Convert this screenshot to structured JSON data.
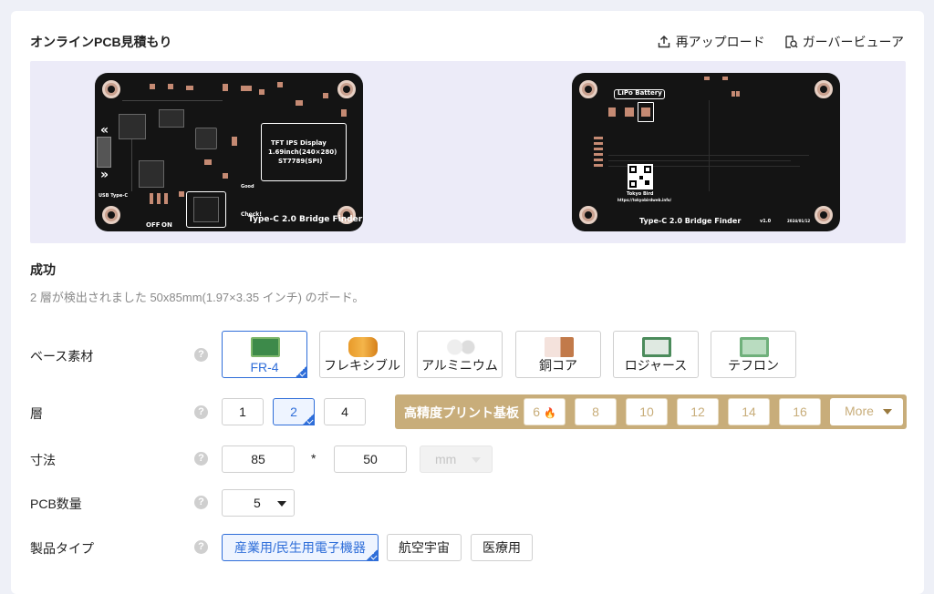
{
  "header": {
    "title": "オンラインPCB見積もり",
    "reupload": "再アップロード",
    "gerber_viewer": "ガーバービューア"
  },
  "preview": {
    "front": {
      "display_l1": "TFT IPS Display",
      "display_l2": "1.69inch(240×280)",
      "display_l3": "ST7789(SPI)",
      "board_name": "Type-C 2.0 Bridge Finder",
      "usb_label": "USB Type-C",
      "off": "OFF",
      "on": "ON",
      "good": "Good",
      "check": "Check!"
    },
    "back": {
      "lipo": "LiPo Battery",
      "board_name": "Type-C 2.0 Bridge Finder",
      "version": "v1.0",
      "date": "2024/01/12",
      "maker": "Tokyo Bird",
      "url": "https://tokyobirdweb.info/"
    }
  },
  "status": {
    "title": "成功",
    "detected": "2 層が検出されました 50x85mm(1.97×3.35 インチ) のボード。"
  },
  "base_material": {
    "label": "ベース素材",
    "help": "?",
    "options": [
      "FR-4",
      "フレキシブル",
      "アルミニウム",
      "銅コア",
      "ロジャース",
      "テフロン"
    ],
    "selected": "FR-4"
  },
  "layers": {
    "label": "層",
    "help": "?",
    "options": [
      "1",
      "2",
      "4"
    ],
    "selected": "2",
    "hp_label": "高精度プリント基板",
    "hp_options": [
      "6",
      "8",
      "10",
      "12",
      "14",
      "16"
    ],
    "hp_fire": "🔥",
    "more": "More"
  },
  "dimensions": {
    "label": "寸法",
    "help": "?",
    "width": "85",
    "separator": "*",
    "height": "50",
    "unit": "mm"
  },
  "quantity": {
    "label": "PCB数量",
    "help": "?",
    "value": "5"
  },
  "product_type": {
    "label": "製品タイプ",
    "help": "?",
    "options": [
      "産業用/民生用電子機器",
      "航空宇宙",
      "医療用"
    ],
    "selected": "産業用/民生用電子機器"
  },
  "colors": {
    "accent": "#2f6ed9",
    "gold": "#c8ad7a",
    "board": "#141414",
    "copper": "#c58a73"
  }
}
